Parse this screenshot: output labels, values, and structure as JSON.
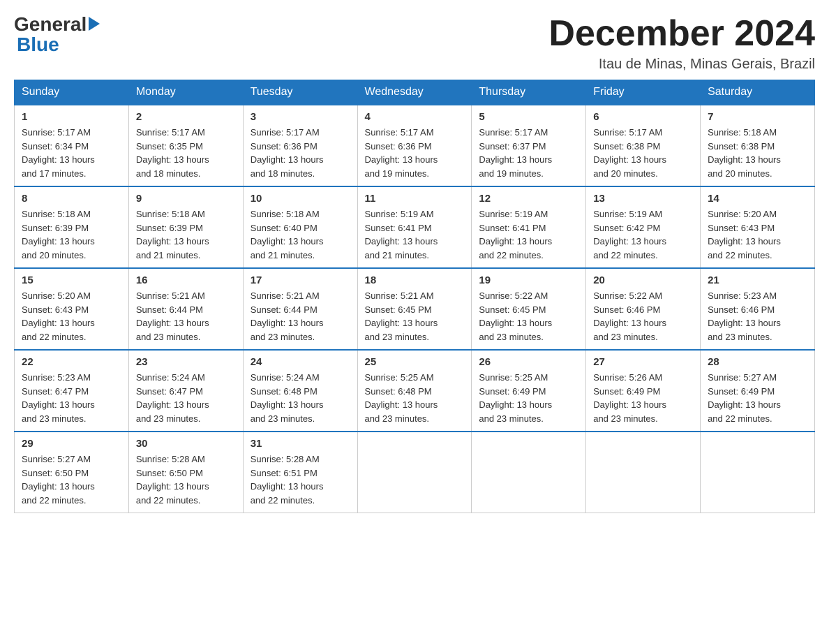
{
  "header": {
    "logo_general": "General",
    "logo_blue": "Blue",
    "month_title": "December 2024",
    "subtitle": "Itau de Minas, Minas Gerais, Brazil"
  },
  "days_of_week": [
    "Sunday",
    "Monday",
    "Tuesday",
    "Wednesday",
    "Thursday",
    "Friday",
    "Saturday"
  ],
  "weeks": [
    [
      {
        "day": "1",
        "sunrise": "5:17 AM",
        "sunset": "6:34 PM",
        "daylight": "13 hours and 17 minutes."
      },
      {
        "day": "2",
        "sunrise": "5:17 AM",
        "sunset": "6:35 PM",
        "daylight": "13 hours and 18 minutes."
      },
      {
        "day": "3",
        "sunrise": "5:17 AM",
        "sunset": "6:36 PM",
        "daylight": "13 hours and 18 minutes."
      },
      {
        "day": "4",
        "sunrise": "5:17 AM",
        "sunset": "6:36 PM",
        "daylight": "13 hours and 19 minutes."
      },
      {
        "day": "5",
        "sunrise": "5:17 AM",
        "sunset": "6:37 PM",
        "daylight": "13 hours and 19 minutes."
      },
      {
        "day": "6",
        "sunrise": "5:17 AM",
        "sunset": "6:38 PM",
        "daylight": "13 hours and 20 minutes."
      },
      {
        "day": "7",
        "sunrise": "5:18 AM",
        "sunset": "6:38 PM",
        "daylight": "13 hours and 20 minutes."
      }
    ],
    [
      {
        "day": "8",
        "sunrise": "5:18 AM",
        "sunset": "6:39 PM",
        "daylight": "13 hours and 20 minutes."
      },
      {
        "day": "9",
        "sunrise": "5:18 AM",
        "sunset": "6:39 PM",
        "daylight": "13 hours and 21 minutes."
      },
      {
        "day": "10",
        "sunrise": "5:18 AM",
        "sunset": "6:40 PM",
        "daylight": "13 hours and 21 minutes."
      },
      {
        "day": "11",
        "sunrise": "5:19 AM",
        "sunset": "6:41 PM",
        "daylight": "13 hours and 21 minutes."
      },
      {
        "day": "12",
        "sunrise": "5:19 AM",
        "sunset": "6:41 PM",
        "daylight": "13 hours and 22 minutes."
      },
      {
        "day": "13",
        "sunrise": "5:19 AM",
        "sunset": "6:42 PM",
        "daylight": "13 hours and 22 minutes."
      },
      {
        "day": "14",
        "sunrise": "5:20 AM",
        "sunset": "6:43 PM",
        "daylight": "13 hours and 22 minutes."
      }
    ],
    [
      {
        "day": "15",
        "sunrise": "5:20 AM",
        "sunset": "6:43 PM",
        "daylight": "13 hours and 22 minutes."
      },
      {
        "day": "16",
        "sunrise": "5:21 AM",
        "sunset": "6:44 PM",
        "daylight": "13 hours and 23 minutes."
      },
      {
        "day": "17",
        "sunrise": "5:21 AM",
        "sunset": "6:44 PM",
        "daylight": "13 hours and 23 minutes."
      },
      {
        "day": "18",
        "sunrise": "5:21 AM",
        "sunset": "6:45 PM",
        "daylight": "13 hours and 23 minutes."
      },
      {
        "day": "19",
        "sunrise": "5:22 AM",
        "sunset": "6:45 PM",
        "daylight": "13 hours and 23 minutes."
      },
      {
        "day": "20",
        "sunrise": "5:22 AM",
        "sunset": "6:46 PM",
        "daylight": "13 hours and 23 minutes."
      },
      {
        "day": "21",
        "sunrise": "5:23 AM",
        "sunset": "6:46 PM",
        "daylight": "13 hours and 23 minutes."
      }
    ],
    [
      {
        "day": "22",
        "sunrise": "5:23 AM",
        "sunset": "6:47 PM",
        "daylight": "13 hours and 23 minutes."
      },
      {
        "day": "23",
        "sunrise": "5:24 AM",
        "sunset": "6:47 PM",
        "daylight": "13 hours and 23 minutes."
      },
      {
        "day": "24",
        "sunrise": "5:24 AM",
        "sunset": "6:48 PM",
        "daylight": "13 hours and 23 minutes."
      },
      {
        "day": "25",
        "sunrise": "5:25 AM",
        "sunset": "6:48 PM",
        "daylight": "13 hours and 23 minutes."
      },
      {
        "day": "26",
        "sunrise": "5:25 AM",
        "sunset": "6:49 PM",
        "daylight": "13 hours and 23 minutes."
      },
      {
        "day": "27",
        "sunrise": "5:26 AM",
        "sunset": "6:49 PM",
        "daylight": "13 hours and 23 minutes."
      },
      {
        "day": "28",
        "sunrise": "5:27 AM",
        "sunset": "6:49 PM",
        "daylight": "13 hours and 22 minutes."
      }
    ],
    [
      {
        "day": "29",
        "sunrise": "5:27 AM",
        "sunset": "6:50 PM",
        "daylight": "13 hours and 22 minutes."
      },
      {
        "day": "30",
        "sunrise": "5:28 AM",
        "sunset": "6:50 PM",
        "daylight": "13 hours and 22 minutes."
      },
      {
        "day": "31",
        "sunrise": "5:28 AM",
        "sunset": "6:51 PM",
        "daylight": "13 hours and 22 minutes."
      },
      null,
      null,
      null,
      null
    ]
  ],
  "labels": {
    "sunrise": "Sunrise:",
    "sunset": "Sunset:",
    "daylight": "Daylight:"
  }
}
